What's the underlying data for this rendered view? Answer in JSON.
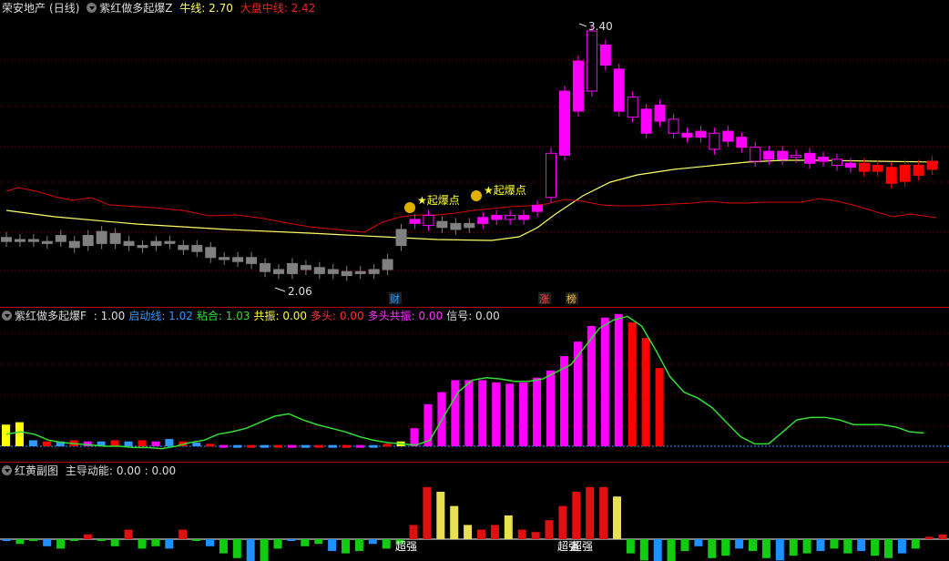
{
  "panel1": {
    "stock_name": "荣安地产",
    "period": "(日线)",
    "indicator": "紫红做多起爆Z",
    "niu_label": "牛线:",
    "niu_value": "2.70",
    "dapan_label": "大盘中线:",
    "dapan_value": "2.42",
    "high_label": "3.40",
    "low_label": "2.06",
    "markers": [
      "★起爆点",
      "★起爆点"
    ],
    "tags": [
      "财",
      "涨",
      "榜"
    ]
  },
  "panel2": {
    "name": "紫红做多起爆F",
    "items": [
      {
        "label": "",
        "value": ": 1.00",
        "color": "#dddddd"
      },
      {
        "label": "启动线:",
        "value": "1.02",
        "color": "#3399ff"
      },
      {
        "label": "粘合:",
        "value": "1.03",
        "color": "#33dd33"
      },
      {
        "label": "共振:",
        "value": "0.00",
        "color": "#ffff33"
      },
      {
        "label": "多头:",
        "value": "0.00",
        "color": "#ff3333"
      },
      {
        "label": "多头共振:",
        "value": "0.00",
        "color": "#ff33ff"
      },
      {
        "label": "信号:",
        "value": "0.00",
        "color": "#dddddd"
      }
    ]
  },
  "panel3": {
    "name": "红黄副图",
    "label": "主导动能:",
    "value": "0.00",
    "value2": ": 0.00",
    "annotations": [
      "超强",
      "超强",
      "超强"
    ]
  },
  "colors": {
    "up_magenta": "#ff00ff",
    "up_red": "#ff0000",
    "down_gray": "#808080",
    "ma_yellow": "#ffff66",
    "ma_red": "#dd0000",
    "green_line": "#33dd33",
    "blue_dotted": "#3399ff"
  },
  "chart_data": {
    "type": "candlestick",
    "price_range": [
      2.06,
      3.4
    ],
    "candles": [
      {
        "o": 2.32,
        "c": 2.3,
        "col": "gray"
      },
      {
        "o": 2.31,
        "c": 2.3,
        "col": "gray"
      },
      {
        "o": 2.31,
        "c": 2.3,
        "col": "gray"
      },
      {
        "o": 2.3,
        "c": 2.29,
        "col": "gray"
      },
      {
        "o": 2.33,
        "c": 2.3,
        "col": "gray"
      },
      {
        "o": 2.3,
        "c": 2.27,
        "col": "gray"
      },
      {
        "o": 2.33,
        "c": 2.28,
        "col": "gray"
      },
      {
        "o": 2.35,
        "c": 2.29,
        "col": "gray"
      },
      {
        "o": 2.34,
        "c": 2.29,
        "col": "gray"
      },
      {
        "o": 2.3,
        "c": 2.28,
        "col": "gray"
      },
      {
        "o": 2.28,
        "c": 2.27,
        "col": "gray"
      },
      {
        "o": 2.3,
        "c": 2.28,
        "col": "gray"
      },
      {
        "o": 2.3,
        "c": 2.29,
        "col": "gray"
      },
      {
        "o": 2.28,
        "c": 2.26,
        "col": "gray"
      },
      {
        "o": 2.28,
        "c": 2.25,
        "col": "gray"
      },
      {
        "o": 2.27,
        "c": 2.22,
        "col": "gray"
      },
      {
        "o": 2.22,
        "c": 2.21,
        "col": "gray"
      },
      {
        "o": 2.22,
        "c": 2.2,
        "col": "gray"
      },
      {
        "o": 2.22,
        "c": 2.19,
        "col": "gray"
      },
      {
        "o": 2.19,
        "c": 2.15,
        "col": "gray"
      },
      {
        "o": 2.16,
        "c": 2.14,
        "col": "gray"
      },
      {
        "o": 2.19,
        "c": 2.14,
        "col": "gray"
      },
      {
        "o": 2.18,
        "c": 2.16,
        "col": "gray"
      },
      {
        "o": 2.17,
        "c": 2.14,
        "col": "gray"
      },
      {
        "o": 2.16,
        "c": 2.14,
        "col": "gray"
      },
      {
        "o": 2.15,
        "c": 2.13,
        "col": "gray"
      },
      {
        "o": 2.15,
        "c": 2.14,
        "col": "gray"
      },
      {
        "o": 2.16,
        "c": 2.14,
        "col": "gray"
      },
      {
        "o": 2.21,
        "c": 2.16,
        "col": "gray"
      },
      {
        "o": 2.36,
        "c": 2.28,
        "col": "gray"
      },
      {
        "o": 2.41,
        "c": 2.39,
        "col": "m"
      },
      {
        "o": 2.43,
        "c": 2.38,
        "col": "m"
      },
      {
        "o": 2.4,
        "c": 2.37,
        "col": "gray"
      },
      {
        "o": 2.39,
        "c": 2.36,
        "col": "gray"
      },
      {
        "o": 2.39,
        "c": 2.37,
        "col": "gray"
      },
      {
        "o": 2.42,
        "c": 2.39,
        "col": "m"
      },
      {
        "o": 2.43,
        "c": 2.41,
        "col": "m"
      },
      {
        "o": 2.43,
        "c": 2.41,
        "col": "m"
      },
      {
        "o": 2.43,
        "c": 2.41,
        "col": "m"
      },
      {
        "o": 2.45,
        "c": 2.48,
        "col": "m"
      },
      {
        "o": 2.52,
        "c": 2.74,
        "col": "m"
      },
      {
        "o": 2.73,
        "c": 3.05,
        "col": "m"
      },
      {
        "o": 2.95,
        "c": 3.2,
        "col": "m"
      },
      {
        "o": 3.05,
        "c": 3.35,
        "col": "m"
      },
      {
        "o": 3.28,
        "c": 3.18,
        "col": "m"
      },
      {
        "o": 3.16,
        "c": 2.95,
        "col": "m"
      },
      {
        "o": 3.02,
        "c": 2.92,
        "col": "m"
      },
      {
        "o": 2.96,
        "c": 2.84,
        "col": "m"
      },
      {
        "o": 2.98,
        "c": 2.9,
        "col": "m"
      },
      {
        "o": 2.91,
        "c": 2.84,
        "col": "m"
      },
      {
        "o": 2.84,
        "c": 2.82,
        "col": "m"
      },
      {
        "o": 2.85,
        "c": 2.82,
        "col": "m"
      },
      {
        "o": 2.84,
        "c": 2.76,
        "col": "m"
      },
      {
        "o": 2.85,
        "c": 2.8,
        "col": "m"
      },
      {
        "o": 2.82,
        "c": 2.77,
        "col": "m"
      },
      {
        "o": 2.77,
        "c": 2.7,
        "col": "m"
      },
      {
        "o": 2.75,
        "c": 2.71,
        "col": "m"
      },
      {
        "o": 2.75,
        "c": 2.71,
        "col": "m"
      },
      {
        "o": 2.73,
        "c": 2.72,
        "col": "m"
      },
      {
        "o": 2.74,
        "c": 2.69,
        "col": "m"
      },
      {
        "o": 2.72,
        "c": 2.7,
        "col": "m"
      },
      {
        "o": 2.71,
        "c": 2.68,
        "col": "m"
      },
      {
        "o": 2.69,
        "c": 2.67,
        "col": "m"
      },
      {
        "o": 2.69,
        "c": 2.65,
        "col": "red"
      },
      {
        "o": 2.68,
        "c": 2.65,
        "col": "red"
      },
      {
        "o": 2.67,
        "c": 2.59,
        "col": "red"
      },
      {
        "o": 2.68,
        "c": 2.6,
        "col": "red"
      },
      {
        "o": 2.68,
        "c": 2.63,
        "col": "red"
      },
      {
        "o": 2.7,
        "c": 2.66,
        "col": "red"
      }
    ],
    "osc_bars": [
      0.18,
      0.2,
      0.05,
      0.04,
      0.04,
      0.05,
      0.04,
      0.04,
      0.05,
      0.04,
      0.05,
      0.04,
      0.06,
      0.04,
      0.03,
      0.02,
      0.01,
      0.01,
      0.01,
      0.01,
      0.01,
      0.01,
      0.01,
      0.01,
      0.01,
      0.01,
      0.01,
      0.01,
      0.02,
      0.04,
      0.15,
      0.35,
      0.45,
      0.55,
      0.55,
      0.55,
      0.53,
      0.52,
      0.53,
      0.57,
      0.63,
      0.75,
      0.87,
      1.0,
      1.07,
      1.1,
      1.03,
      0.9,
      0.65
    ],
    "osc_line": [
      0.1,
      0.12,
      0.1,
      0.05,
      0.03,
      0.02,
      0.01,
      0.0,
      0.0,
      -0.01,
      -0.01,
      -0.02,
      0.0,
      0.03,
      0.05,
      0.1,
      0.12,
      0.15,
      0.2,
      0.25,
      0.27,
      0.22,
      0.18,
      0.15,
      0.12,
      0.08,
      0.05,
      0.03,
      0.02,
      0.01,
      0.05,
      0.25,
      0.45,
      0.55,
      0.57,
      0.56,
      0.54,
      0.54,
      0.56,
      0.62,
      0.68,
      0.83,
      0.98,
      1.05,
      1.08,
      1.0,
      0.8,
      0.58,
      0.45,
      0.4,
      0.32,
      0.2,
      0.08,
      0.02,
      0.02,
      0.12,
      0.22,
      0.24,
      0.24,
      0.22,
      0.18,
      0.18,
      0.18,
      0.16,
      0.12,
      0.11
    ],
    "momentum": [
      0.0,
      -0.02,
      0.0,
      -0.03,
      -0.04,
      0.0,
      0.02,
      0.0,
      -0.03,
      0.04,
      -0.04,
      -0.03,
      -0.04,
      0.04,
      0.0,
      -0.03,
      -0.06,
      -0.08,
      -0.1,
      -0.12,
      -0.04,
      0.0,
      -0.03,
      -0.02,
      -0.05,
      -0.06,
      -0.05,
      -0.02,
      -0.04,
      -0.02,
      0.06,
      0.22,
      0.2,
      0.14,
      0.06,
      0.04,
      0.06,
      0.1,
      0.04,
      0.03,
      0.08,
      0.14,
      0.2,
      0.22,
      0.22,
      0.18,
      -0.06,
      -0.09,
      -0.12,
      -0.1,
      -0.05,
      -0.03,
      -0.08,
      -0.07,
      -0.04,
      -0.05,
      -0.08,
      -0.09,
      -0.07,
      -0.06,
      -0.05,
      -0.04,
      -0.06,
      -0.05,
      -0.07,
      -0.08,
      -0.06,
      -0.04,
      0.01,
      0.02
    ]
  }
}
